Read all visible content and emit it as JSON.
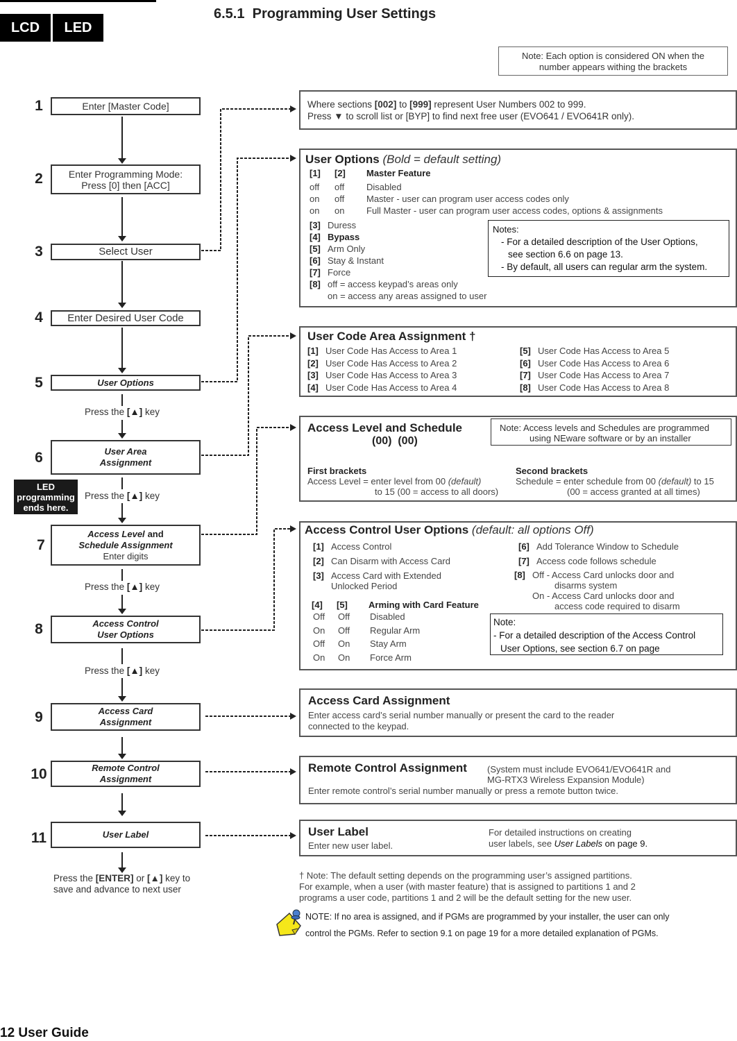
{
  "header": {
    "tabs": [
      "LCD",
      "LED"
    ],
    "section_number": "6.5.1",
    "section_title": "Programming User Settings"
  },
  "top_note": {
    "line1": "Note:  Each option is considered ON when the",
    "line2": "number appears withing the brackets"
  },
  "steps": [
    {
      "num": "1",
      "lines": [
        "Enter [Master Code]"
      ]
    },
    {
      "num": "2",
      "lines": [
        "Enter Programming Mode:",
        "Press [0] then [ACC]"
      ]
    },
    {
      "num": "3",
      "lines": [
        "Select User"
      ]
    },
    {
      "num": "4",
      "lines": [
        "Enter Desired User Code"
      ]
    },
    {
      "num": "5",
      "lines": [
        "User Options"
      ]
    },
    {
      "num": "6",
      "lines": [
        "User Area",
        "Assignment"
      ]
    },
    {
      "num": "7",
      "lines": [
        "Access Level",
        "and",
        "Schedule Assignment",
        "Enter digits"
      ]
    },
    {
      "num": "8",
      "lines": [
        "Access Control",
        "User Options"
      ]
    },
    {
      "num": "9",
      "lines": [
        "Access Card",
        "Assignment"
      ]
    },
    {
      "num": "10",
      "lines": [
        "Remote Control",
        "Assignment"
      ]
    },
    {
      "num": "11",
      "lines": [
        "User Label"
      ]
    }
  ],
  "press_key": {
    "prefix": "Press the ",
    "key": "[▲]",
    "suffix": " key"
  },
  "led_end": {
    "line1": "LED",
    "line2": "programming",
    "line3": "ends here."
  },
  "final_press": {
    "prefix": "Press the ",
    "enter": "[ENTER]",
    "mid": " or ",
    "key": "[▲]",
    "suffix": " key to",
    "line2": "save and advance to next user"
  },
  "select_user_box": {
    "l1_a": "Where sections ",
    "l1_b": "[002]",
    "l1_c": " to ",
    "l1_d": "[999]",
    "l1_e": " represent User Numbers 002 to 999.",
    "l2": "Press ▼ to scroll list or [BYP] to find next free user (EVO641 / EVO641R only)."
  },
  "user_options": {
    "title": "User Options",
    "subtitle": "(Bold = default setting)",
    "header": [
      "[1]",
      "[2]",
      "Master Feature"
    ],
    "master_rows": [
      [
        "off",
        "off",
        "Disabled"
      ],
      [
        "on",
        "off",
        "Master - user can program user access codes only"
      ],
      [
        "on",
        "on",
        "Full Master - user can program user access codes, options & assignments"
      ]
    ],
    "options": [
      {
        "key": "[3]",
        "label": "Duress",
        "bold": false
      },
      {
        "key": "[4]",
        "label": "Bypass",
        "bold": true
      },
      {
        "key": "[5]",
        "label": "Arm Only",
        "bold": false
      },
      {
        "key": "[6]",
        "label": "Stay & Instant",
        "bold": false
      },
      {
        "key": "[7]",
        "label": "Force",
        "bold": false
      },
      {
        "key": "[8]",
        "label": "off = access keypad’s areas only",
        "bold": false
      }
    ],
    "option8_line2": "on = access any areas assigned to user",
    "notes": {
      "title": "Notes:",
      "line1": "- For a detailed description of the User Options,",
      "line2": "see section 6.6 on page 13.",
      "line3": "- By default, all users can regular arm the system."
    }
  },
  "area_assignment": {
    "title": "User Code Area Assignment †",
    "left": [
      [
        "[1]",
        "User Code Has Access to Area 1"
      ],
      [
        "[2]",
        "User Code Has Access to Area 2"
      ],
      [
        "[3]",
        "User Code Has Access to Area 3"
      ],
      [
        "[4]",
        "User Code Has Access to Area 4"
      ]
    ],
    "right": [
      [
        "[5]",
        "User Code Has Access to Area 5"
      ],
      [
        "[6]",
        "User Code Has Access to Area 6"
      ],
      [
        "[7]",
        "User Code Has Access to Area 7"
      ],
      [
        "[8]",
        "User Code Has Access to Area 8"
      ]
    ]
  },
  "access_level": {
    "title": "Access Level and Schedule",
    "brackets": "(00)  (00)",
    "note_line1": "Note:  Access levels and Schedules are programmed",
    "note_line2": "using NEware software or by an installer",
    "first_title": "First brackets",
    "first_l1a": "Access Level = enter level from 00 ",
    "first_l1b": "(default)",
    "first_l2": "to 15 (00 = access to all doors)",
    "second_title": "Second brackets",
    "second_l1a": "Schedule = enter schedule from 00 ",
    "second_l1b": "(default)",
    "second_l1c": " to 15",
    "second_l2": "(00 = access granted at all times)"
  },
  "access_control": {
    "title": "Access Control User Options",
    "subtitle": "(default: all options Off)",
    "left": [
      [
        "[1]",
        "Access Control"
      ],
      [
        "[2]",
        "Can Disarm with Access Card"
      ],
      [
        "[3]",
        "Access Card with Extended",
        "Unlocked Period"
      ]
    ],
    "right": [
      [
        "[6]",
        "Add Tolerance Window to Schedule"
      ],
      [
        "[7]",
        "Access code follows schedule"
      ]
    ],
    "opt8_key": "[8]",
    "opt8_off_1": "Off - Access Card unlocks door and",
    "opt8_off_2": "disarms system",
    "opt8_on_1": "On - Access Card unlocks door and",
    "opt8_on_2": "access code required to disarm",
    "card_header": [
      "[4]",
      "[5]",
      "Arming with Card Feature"
    ],
    "card_rows": [
      [
        "Off",
        "Off",
        "Disabled"
      ],
      [
        "On",
        "Off",
        "Regular Arm"
      ],
      [
        "Off",
        "On",
        "Stay Arm"
      ],
      [
        "On",
        "On",
        "Force Arm"
      ]
    ],
    "note_title": "Note:",
    "note_l1": "- For a detailed description of the Access Control",
    "note_l2": "User Options, see section 6.7 on page"
  },
  "access_card": {
    "title": "Access Card Assignment",
    "l1": "Enter access card’s serial number manually or present the card to the reader",
    "l2": "connected to the keypad."
  },
  "remote_control": {
    "title": "Remote Control Assignment",
    "req1": "(System must include EVO641/EVO641R and",
    "req2": "MG-RTX3 Wireless Expansion Module)",
    "l1": "Enter remote control’s serial number manually or press a remote button twice."
  },
  "user_label": {
    "title": "User Label",
    "l1": "Enter new user label.",
    "r1": "For detailed instructions on creating",
    "r2a": "user labels, see ",
    "r2b": "User Labels",
    "r2c": " on page 9."
  },
  "footnote": {
    "l1": "† Note: The default setting depends on the programming user’s assigned partitions.",
    "l2": "For example, when a user (with master feature) that is assigned to partitions 1 and 2",
    "l3": "programs a user code, partitions 1 and 2 will be the default setting for the new user."
  },
  "pgm_note": {
    "l1": "NOTE: If no area is assigned, and if PGMs are programmed by your installer, the user can only",
    "l2": "control the PGMs. Refer to section 9.1 on page 19 for a more detailed explanation of PGMs."
  },
  "footer": {
    "page": "12 User Guide"
  }
}
